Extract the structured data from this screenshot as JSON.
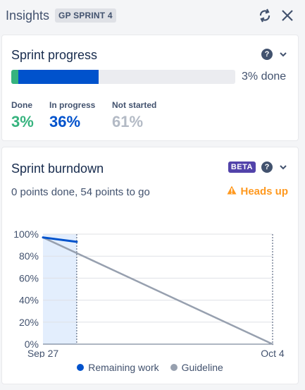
{
  "header": {
    "title": "Insights",
    "sprint_badge": "GP SPRINT 4"
  },
  "sprint_progress": {
    "title": "Sprint progress",
    "progress_label": "3% done",
    "stats": [
      {
        "label": "Done",
        "value": "3%",
        "color": "#36b37e"
      },
      {
        "label": "In progress",
        "value": "36%",
        "color": "#0052cc"
      },
      {
        "label": "Not started",
        "value": "61%",
        "color": "#b3bac5"
      }
    ],
    "done_fraction": 0.03,
    "in_progress_fraction": 0.36,
    "colors": {
      "done": "#36b37e",
      "in_progress": "#0052cc",
      "not_started": "#ebecf0"
    }
  },
  "sprint_burndown": {
    "title": "Sprint burndown",
    "beta_label": "BETA",
    "summary": "0 points done, 54 points to go",
    "heads_up_label": "Heads up",
    "legend": {
      "remaining": "Remaining work",
      "guideline": "Guideline"
    }
  },
  "chart_data": {
    "type": "line",
    "y_ticks": [
      "100%",
      "80%",
      "60%",
      "40%",
      "20%",
      "0%"
    ],
    "ylim": [
      0,
      100
    ],
    "x_tick_labels": [
      "Sep 27",
      "Oct 4"
    ],
    "series": [
      {
        "name": "Remaining work",
        "color": "#0052cc",
        "points": [
          [
            0,
            97
          ],
          [
            0.147,
            93
          ]
        ]
      },
      {
        "name": "Guideline",
        "color": "#97a0af",
        "points": [
          [
            0,
            97
          ],
          [
            1,
            0
          ]
        ]
      }
    ],
    "current_day_fraction": 0.147,
    "grid": true
  },
  "icons": {
    "refresh": "refresh-icon",
    "close": "close-icon",
    "help": "help-icon",
    "chevron": "chevron-down-icon",
    "warning": "warning-icon"
  }
}
